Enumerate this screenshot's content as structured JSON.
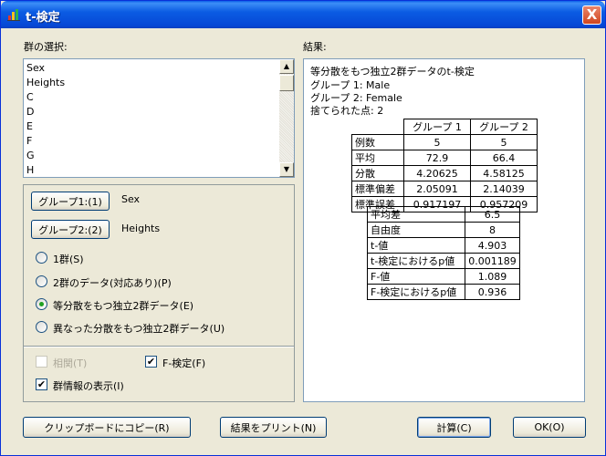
{
  "window": {
    "title": "t-検定",
    "close_label": "X"
  },
  "groups_section": {
    "label": "群の選択:"
  },
  "results_section": {
    "label": "結果:"
  },
  "variables": [
    "Sex",
    "Heights",
    "C",
    "D",
    "E",
    "F",
    "G",
    "H"
  ],
  "group1": {
    "button_label": "グループ1:(1)",
    "value": "Sex"
  },
  "group2": {
    "button_label": "グループ2:(2)",
    "value": "Heights"
  },
  "test_types": [
    {
      "label": "1群(S)",
      "selected": false
    },
    {
      "label": "2群のデータ(対応あり)(P)",
      "selected": false
    },
    {
      "label": "等分散をもつ独立2群データ(E)",
      "selected": true
    },
    {
      "label": "異なった分散をもつ独立2群データ(U)",
      "selected": false
    }
  ],
  "options": {
    "correlation": {
      "label": "相関(T)",
      "checked": false,
      "enabled": false
    },
    "f_test": {
      "label": "F-検定(F)",
      "checked": true
    },
    "group_info": {
      "label": "群情報の表示(I)",
      "checked": true
    }
  },
  "results": {
    "heading": "等分散をもつ独立2群データのt-検定",
    "group1_line": "グループ 1:  Male",
    "group2_line": "グループ 2:  Female",
    "discarded_line": "捨てられた点:  2",
    "group_table": {
      "headers": [
        "グループ 1",
        "グループ 2"
      ],
      "rows": [
        {
          "label": "例数",
          "g1": "5",
          "g2": "5"
        },
        {
          "label": "平均",
          "g1": "72.9",
          "g2": "66.4"
        },
        {
          "label": "分散",
          "g1": "4.20625",
          "g2": "4.58125"
        },
        {
          "label": "標準偏差",
          "g1": "2.05091",
          "g2": "2.14039"
        },
        {
          "label": "標準誤差",
          "g1": "0.917197",
          "g2": "0.957209"
        }
      ]
    },
    "test_table": [
      {
        "label": "平均差",
        "value": "6.5"
      },
      {
        "label": "自由度",
        "value": "8"
      },
      {
        "label": "t-値",
        "value": "4.903"
      },
      {
        "label": "t-検定におけるp値",
        "value": "0.001189"
      },
      {
        "label": "F-値",
        "value": "1.089"
      },
      {
        "label": "F-検定におけるp値",
        "value": "0.936"
      }
    ]
  },
  "buttons": {
    "copy": "クリップボードにコピー(R)",
    "print": "結果をプリント(N)",
    "calculate": "計算(C)",
    "ok": "OK(O)"
  },
  "colors": {
    "titlebar": "#0a5fe8",
    "radio_selected": "#21a121",
    "window_bg": "#ece9d8"
  }
}
